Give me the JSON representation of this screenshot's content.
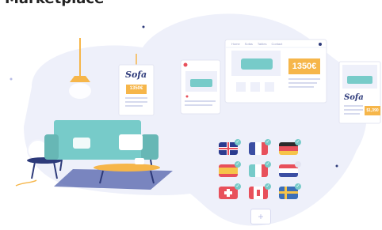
{
  "header": {
    "title": "Marketplace"
  },
  "listings": {
    "small_card_price": "1350€",
    "laptop_price": "1350€",
    "right_card_price": "$1,390",
    "brand_small": "Sofa",
    "brand_right": "Sofa"
  },
  "laptop": {
    "tabs": [
      "Home",
      "Sofas",
      "Tables",
      "Contact"
    ]
  },
  "languages": [
    {
      "country": "United Kingdom",
      "selected": true
    },
    {
      "country": "France",
      "selected": true
    },
    {
      "country": "Germany",
      "selected": true
    },
    {
      "country": "Spain",
      "selected": true
    },
    {
      "country": "Italy",
      "selected": true
    },
    {
      "country": "Netherlands",
      "selected": false
    },
    {
      "country": "Switzerland",
      "selected": true
    },
    {
      "country": "Canada",
      "selected": true
    },
    {
      "country": "Sweden",
      "selected": true
    }
  ],
  "add_button": {
    "symbol": "+"
  },
  "colors": {
    "accent": "#f6b64a",
    "navy": "#2d3a7a",
    "sofa": "#77cbc9",
    "blob": "#eef0fa"
  }
}
